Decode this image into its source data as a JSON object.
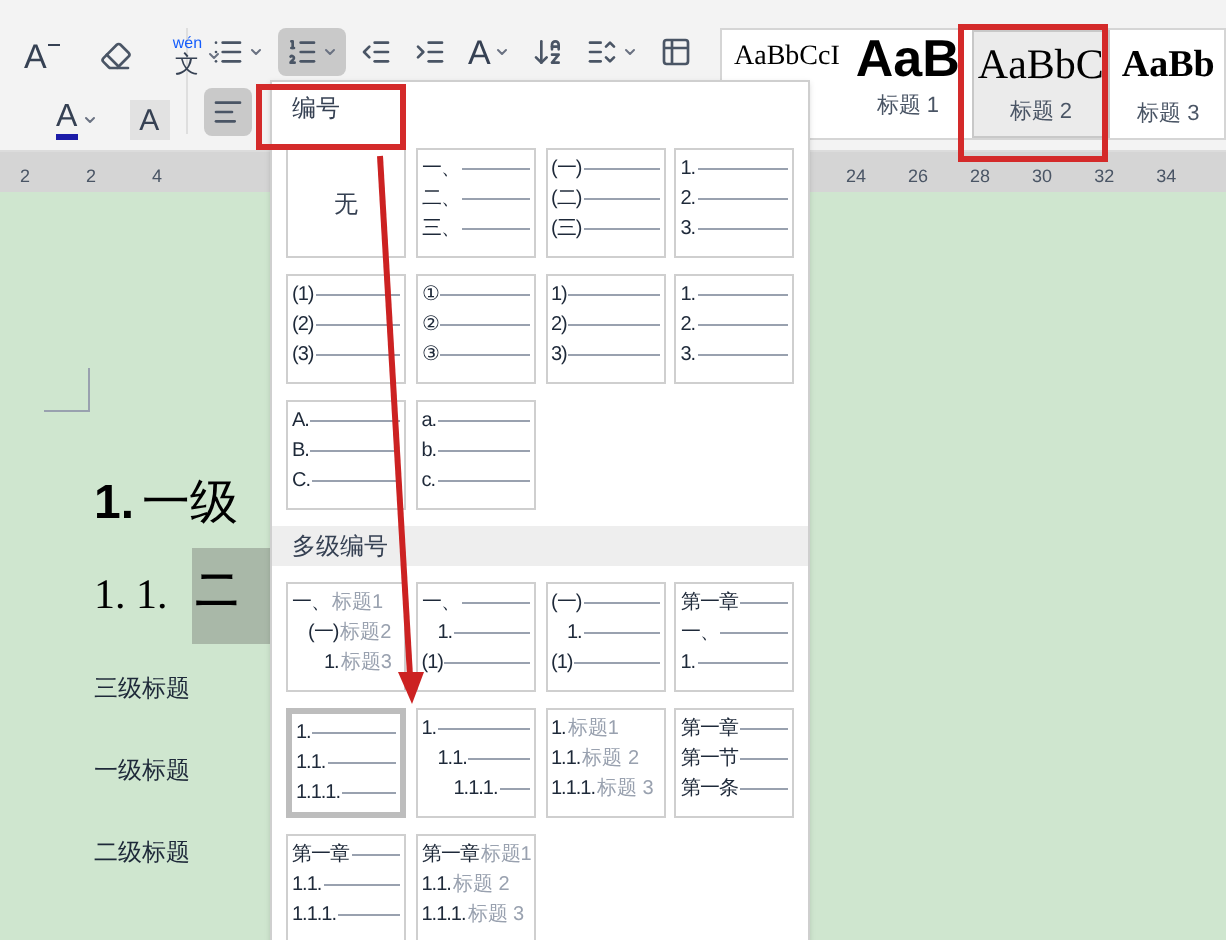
{
  "toolbar": {
    "font_row1": [
      {
        "kind": "shrink",
        "label": "A"
      },
      {
        "kind": "eraser"
      },
      {
        "kind": "pinyin",
        "label": "wén",
        "sub": "文"
      }
    ],
    "font_row2": [
      {
        "kind": "font_color",
        "label": "A"
      },
      {
        "kind": "shading",
        "label": "A"
      }
    ],
    "para_row1": [
      {
        "kind": "bullets",
        "selected": false
      },
      {
        "kind": "numbering",
        "selected": true
      },
      {
        "kind": "outdent",
        "selected": false
      },
      {
        "kind": "indent",
        "selected": false
      },
      {
        "kind": "text_direction",
        "label": "A",
        "selected": false
      },
      {
        "kind": "sort",
        "selected": false
      },
      {
        "kind": "line_spacing",
        "selected": false
      },
      {
        "kind": "border",
        "selected": false
      }
    ],
    "para_row2": [
      {
        "kind": "align_left",
        "selected": true
      }
    ],
    "styles": [
      {
        "kind": "body",
        "sample": "AaBbCcI",
        "selected": false
      },
      {
        "kind": "h1",
        "sample": "AaB",
        "label": "标题 1",
        "selected": false
      },
      {
        "kind": "h2",
        "sample": "AaBbC",
        "label": "标题 2",
        "selected": true
      },
      {
        "kind": "h3",
        "sample": "AaBb",
        "label": "标题 3",
        "selected": false
      }
    ]
  },
  "ruler": {
    "left_ticks": [
      "2",
      "2",
      "4"
    ],
    "right_ticks": [
      "24",
      "26",
      "28",
      "30",
      "32",
      "34"
    ]
  },
  "document": {
    "heading1": {
      "number": "1.",
      "text": "一级"
    },
    "heading2": {
      "number": "1. 1.",
      "text": "二",
      "selected": true
    },
    "paragraphs": [
      "三级标题",
      "一级标题",
      "二级标题"
    ]
  },
  "numbering_menu": {
    "title": "编号",
    "items": [
      {
        "kind": "none",
        "label": "无",
        "selected": false
      },
      {
        "kind": "flat",
        "selected": false,
        "rows": [
          {
            "label": "一、"
          },
          {
            "label": "二、"
          },
          {
            "label": "三、"
          }
        ]
      },
      {
        "kind": "flat",
        "selected": false,
        "rows": [
          {
            "label": "(一)"
          },
          {
            "label": "(二)"
          },
          {
            "label": "(三)"
          }
        ]
      },
      {
        "kind": "flat",
        "selected": false,
        "rows": [
          {
            "label": "1."
          },
          {
            "label": "2."
          },
          {
            "label": "3."
          }
        ]
      },
      {
        "kind": "flat",
        "selected": false,
        "rows": [
          {
            "label": "(1)"
          },
          {
            "label": "(2)"
          },
          {
            "label": "(3)"
          }
        ]
      },
      {
        "kind": "flat",
        "selected": false,
        "rows": [
          {
            "label": "①"
          },
          {
            "label": "②"
          },
          {
            "label": "③"
          }
        ]
      },
      {
        "kind": "flat",
        "selected": false,
        "rows": [
          {
            "label": "1)"
          },
          {
            "label": "2)"
          },
          {
            "label": "3)"
          }
        ]
      },
      {
        "kind": "flat",
        "selected": false,
        "rows": [
          {
            "label": "1."
          },
          {
            "label": "2."
          },
          {
            "label": "3."
          }
        ]
      },
      {
        "kind": "flat",
        "selected": false,
        "rows": [
          {
            "label": "A."
          },
          {
            "label": "B."
          },
          {
            "label": "C."
          }
        ]
      },
      {
        "kind": "flat",
        "selected": false,
        "rows": [
          {
            "label": "a."
          },
          {
            "label": "b."
          },
          {
            "label": "c."
          }
        ]
      }
    ],
    "multilevel_title": "多级编号",
    "multilevel_items": [
      {
        "kind": "stepped",
        "selected": false,
        "rows": [
          {
            "label": "一、",
            "text": "标题1"
          },
          {
            "label": "(一)",
            "text": "标题2"
          },
          {
            "label": "1.",
            "text": "标题3"
          }
        ]
      },
      {
        "kind": "middle",
        "selected": false,
        "rows": [
          {
            "label": "一、"
          },
          {
            "label": "1."
          },
          {
            "label": "(1)"
          }
        ]
      },
      {
        "kind": "middle",
        "selected": false,
        "rows": [
          {
            "label": "(一)"
          },
          {
            "label": "1."
          },
          {
            "label": "(1)"
          }
        ]
      },
      {
        "kind": "flat",
        "selected": false,
        "rows": [
          {
            "label": "第一章"
          },
          {
            "label": "一、"
          },
          {
            "label": "1."
          }
        ]
      },
      {
        "kind": "flat",
        "selected": true,
        "rows": [
          {
            "label": "1."
          },
          {
            "label": "1.1."
          },
          {
            "label": "1.1.1."
          }
        ]
      },
      {
        "kind": "stepped",
        "selected": false,
        "rows": [
          {
            "label": "1."
          },
          {
            "label": "1.1."
          },
          {
            "label": "1.1.1."
          }
        ]
      },
      {
        "kind": "flat",
        "selected": false,
        "rows": [
          {
            "label": "1.",
            "text": "标题1"
          },
          {
            "label": "1.1.",
            "text": "标题 2"
          },
          {
            "label": "1.1.1.",
            "text": "标题 3"
          }
        ]
      },
      {
        "kind": "flat",
        "selected": false,
        "rows": [
          {
            "label": "第一章"
          },
          {
            "label": "第一节"
          },
          {
            "label": "第一条"
          }
        ]
      },
      {
        "kind": "flat",
        "selected": false,
        "rows": [
          {
            "label": "第一章"
          },
          {
            "label": "1.1."
          },
          {
            "label": "1.1.1."
          }
        ]
      },
      {
        "kind": "flat",
        "selected": false,
        "rows": [
          {
            "label": "第一章",
            "text": "标题1"
          },
          {
            "label": "1.1.",
            "text": "标题 2"
          },
          {
            "label": "1.1.1.",
            "text": "标题 3"
          }
        ]
      }
    ]
  }
}
